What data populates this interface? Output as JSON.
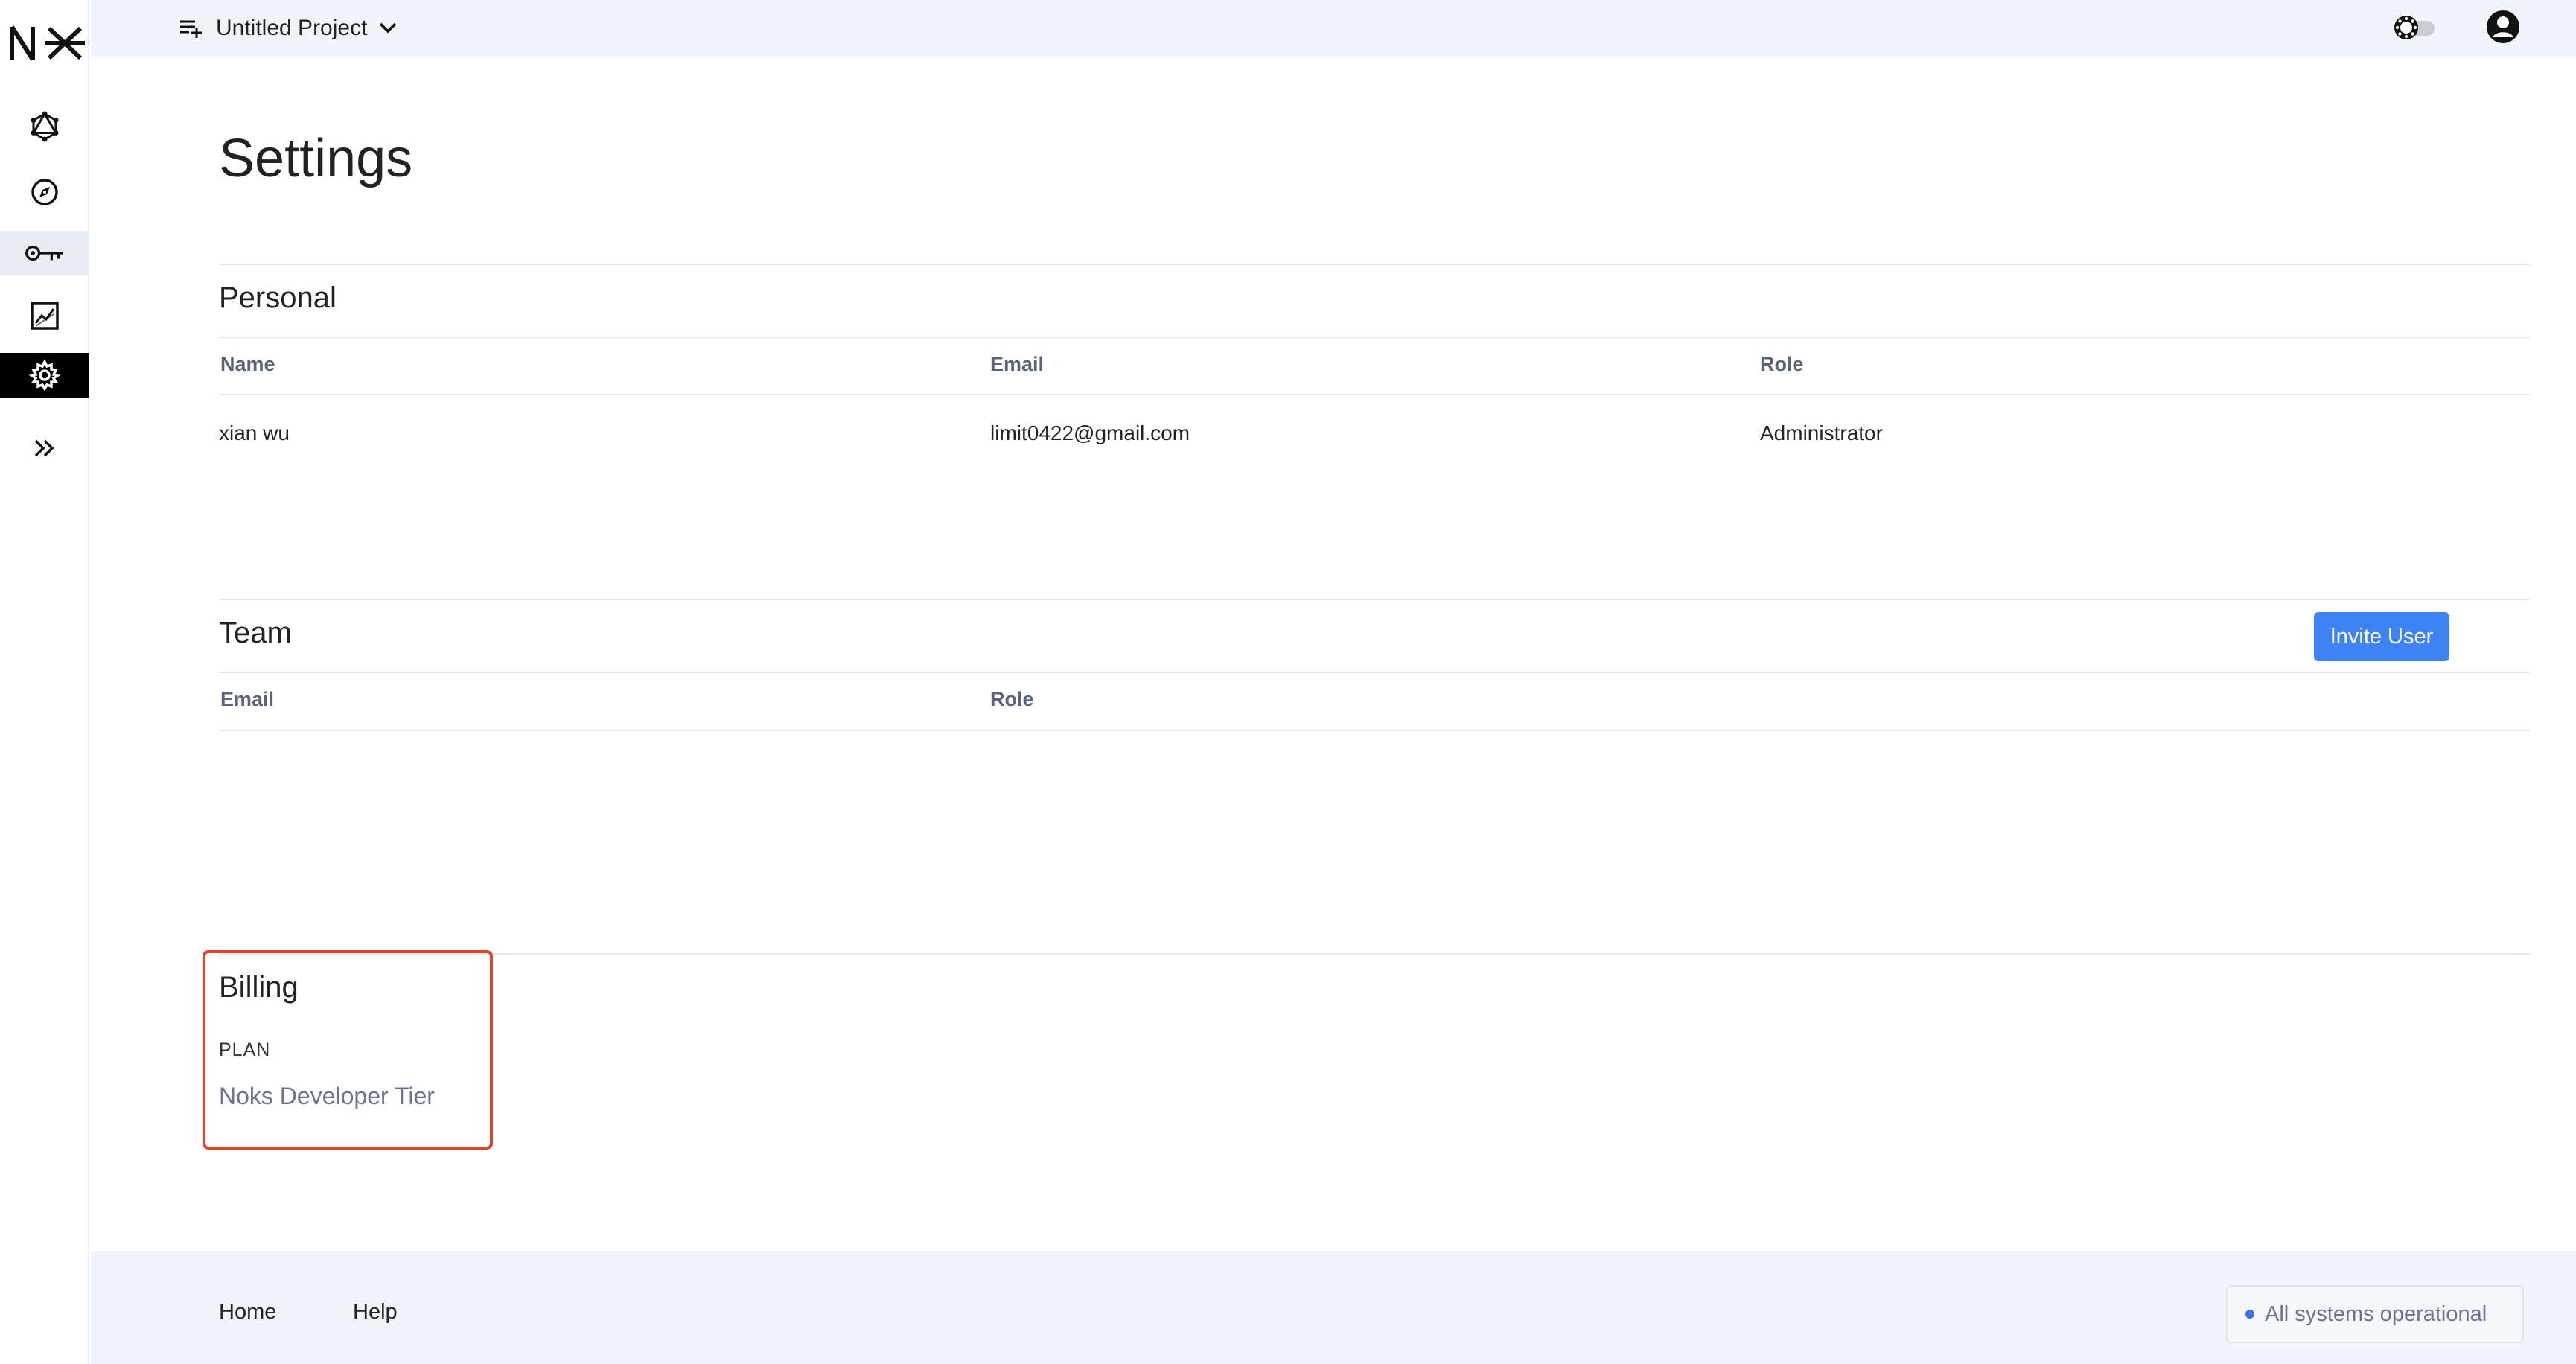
{
  "app": {
    "logo_text": "NX"
  },
  "sidebar": {
    "items": [
      {
        "name": "graphql",
        "icon": "graphql-icon"
      },
      {
        "name": "explore",
        "icon": "compass-icon"
      },
      {
        "name": "api-keys",
        "icon": "key-icon"
      },
      {
        "name": "analytics",
        "icon": "chart-icon"
      },
      {
        "name": "settings",
        "icon": "gear-icon",
        "active": true
      },
      {
        "name": "expand",
        "icon": "double-chevron-right-icon"
      }
    ]
  },
  "topbar": {
    "project_name": "Untitled Project",
    "theme_icon": "theme-toggle-icon",
    "avatar_icon": "user-avatar-icon"
  },
  "page": {
    "title": "Settings"
  },
  "personal": {
    "title": "Personal",
    "columns": [
      "Name",
      "Email",
      "Role"
    ],
    "rows": [
      {
        "name": "xian wu",
        "email": "limit0422@gmail.com",
        "role": "Administrator"
      }
    ]
  },
  "team": {
    "title": "Team",
    "invite_label": "Invite User",
    "columns": [
      "Email",
      "Role"
    ],
    "rows": []
  },
  "billing": {
    "title": "Billing",
    "plan_label": "PLAN",
    "plan_value": "Noks Developer Tier",
    "highlight_color": "#e0442c"
  },
  "footer": {
    "links": [
      "Home",
      "Help"
    ],
    "status_text": "All systems operational",
    "status_color": "#3f6fe0"
  },
  "colors": {
    "accent": "#3f82f3",
    "active_nav": "#000000"
  }
}
